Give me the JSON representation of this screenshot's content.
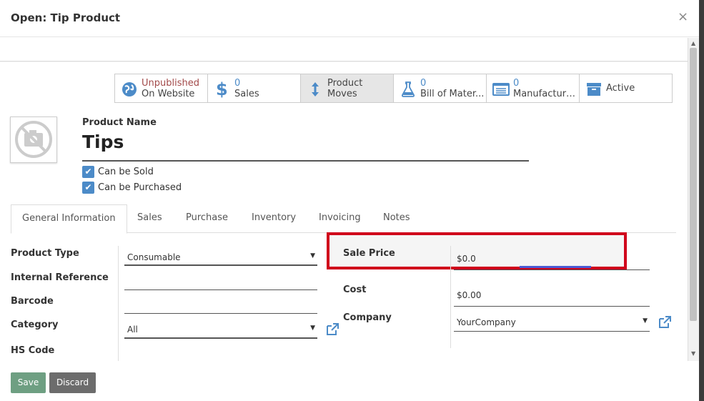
{
  "modal": {
    "title": "Open: Tip Product",
    "close_label": "×"
  },
  "smart_buttons": {
    "website": {
      "line1": "Unpublished",
      "line2": "On Website",
      "icon": "globe-icon"
    },
    "sales": {
      "count": "0",
      "label": "Sales",
      "icon": "dollar-icon"
    },
    "moves": {
      "line1": "Product",
      "line2": "Moves",
      "icon": "up-down-arrows-icon"
    },
    "bom": {
      "count": "0",
      "label": "Bill of Mater...",
      "icon": "flask-icon"
    },
    "manufacturing": {
      "count": "0",
      "label": "Manufacturi...",
      "icon": "list-icon"
    },
    "active": {
      "label": "Active",
      "icon": "archive-box-icon"
    }
  },
  "product": {
    "name_label": "Product Name",
    "name": "Tips",
    "can_be_sold_label": "Can be Sold",
    "can_be_sold": true,
    "can_be_purchased_label": "Can be Purchased",
    "can_be_purchased": true
  },
  "tabs": [
    "General Information",
    "Sales",
    "Purchase",
    "Inventory",
    "Invoicing",
    "Notes"
  ],
  "general": {
    "product_type_label": "Product Type",
    "product_type_value": "Consumable",
    "internal_reference_label": "Internal Reference",
    "internal_reference_value": "",
    "barcode_label": "Barcode",
    "barcode_value": "",
    "category_label": "Category",
    "category_value": "All",
    "hs_code_label": "HS Code",
    "sale_price_label": "Sale Price",
    "sale_price_value": "$0.0",
    "cost_label": "Cost",
    "cost_value": "$0.00",
    "company_label": "Company",
    "company_value": "YourCompany"
  },
  "footer": {
    "save_label": "Save",
    "discard_label": "Discard"
  },
  "colors": {
    "highlight": "#d0021b",
    "accent": "#4c8bc8",
    "save": "#6e9f82",
    "discard": "#6c6c6c"
  }
}
